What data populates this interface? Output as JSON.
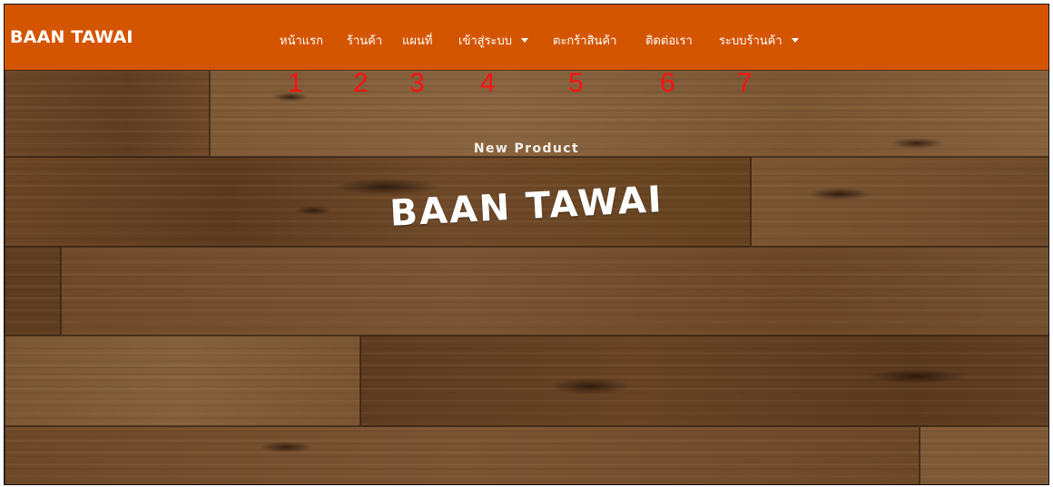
{
  "navbar": {
    "brand": "BAAN TAWAI",
    "color": "#d45500",
    "items": [
      {
        "label": "หน้าแรก",
        "dropdown": false
      },
      {
        "label": "ร้านค้า",
        "dropdown": false
      },
      {
        "label": "แผนที่",
        "dropdown": false
      },
      {
        "label": "เข้าสู่ระบบ",
        "dropdown": true
      },
      {
        "label": "ตะกร้าสินค้า",
        "dropdown": false
      },
      {
        "label": "ติดต่อเรา",
        "dropdown": false
      },
      {
        "label": "ระบบร้านค้า",
        "dropdown": true
      }
    ]
  },
  "annotations": [
    "1",
    "2",
    "3",
    "4",
    "5",
    "6",
    "7"
  ],
  "annotation_color": "#ff1111",
  "hero": {
    "subtitle": "New Product",
    "title": "BAAN TAWAI"
  }
}
